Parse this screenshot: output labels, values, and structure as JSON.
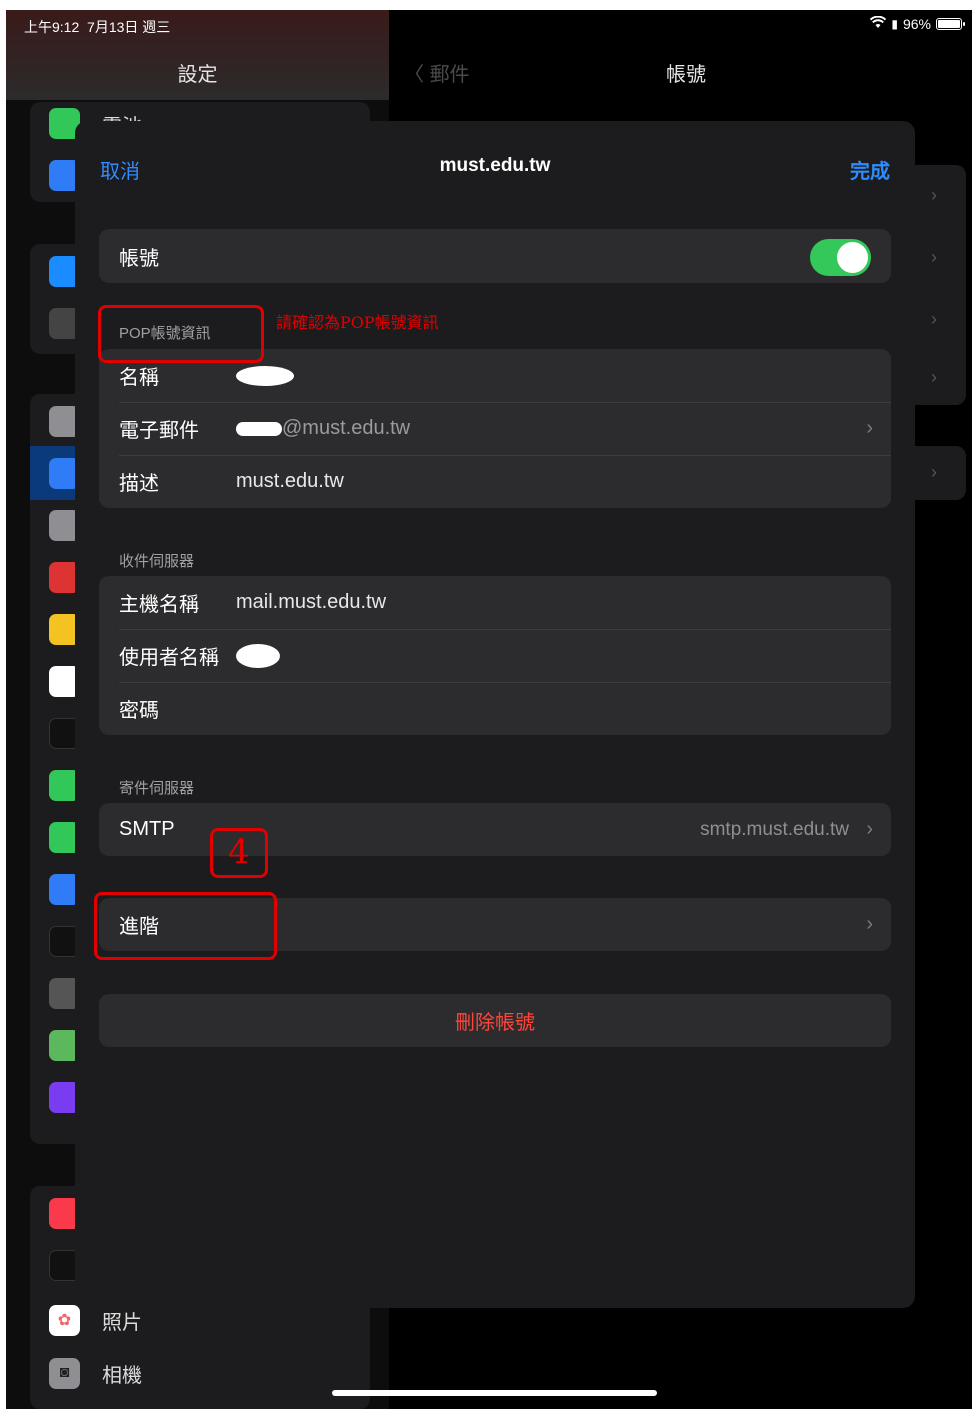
{
  "status_bar": {
    "time": "上午9:12",
    "date": "7月13日 週三",
    "battery": "96%"
  },
  "sidebar": {
    "title": "設定",
    "partial_item": "電池",
    "bottom_items": [
      {
        "label": "照片",
        "icon": "photos-icon"
      },
      {
        "label": "相機",
        "icon": "camera-icon"
      }
    ]
  },
  "detail": {
    "back_label": "郵件",
    "title": "帳號"
  },
  "modal": {
    "cancel": "取消",
    "title": "must.edu.tw",
    "done": "完成",
    "account_label": "帳號",
    "account_enabled": true,
    "pop_section_header": "POP帳號資訊",
    "pop_rows": {
      "name_label": "名稱",
      "email_label": "電子郵件",
      "email_value": "@must.edu.tw",
      "description_label": "描述",
      "description_value": "must.edu.tw"
    },
    "incoming_header": "收件伺服器",
    "incoming_rows": {
      "host_label": "主機名稱",
      "host_value": "mail.must.edu.tw",
      "user_label": "使用者名稱",
      "password_label": "密碼"
    },
    "outgoing_header": "寄件伺服器",
    "smtp_label": "SMTP",
    "smtp_value": "smtp.must.edu.tw",
    "advanced_label": "進階",
    "delete_label": "刪除帳號"
  },
  "annotations": {
    "note": "請確認為POP帳號資訊",
    "step": "4"
  }
}
